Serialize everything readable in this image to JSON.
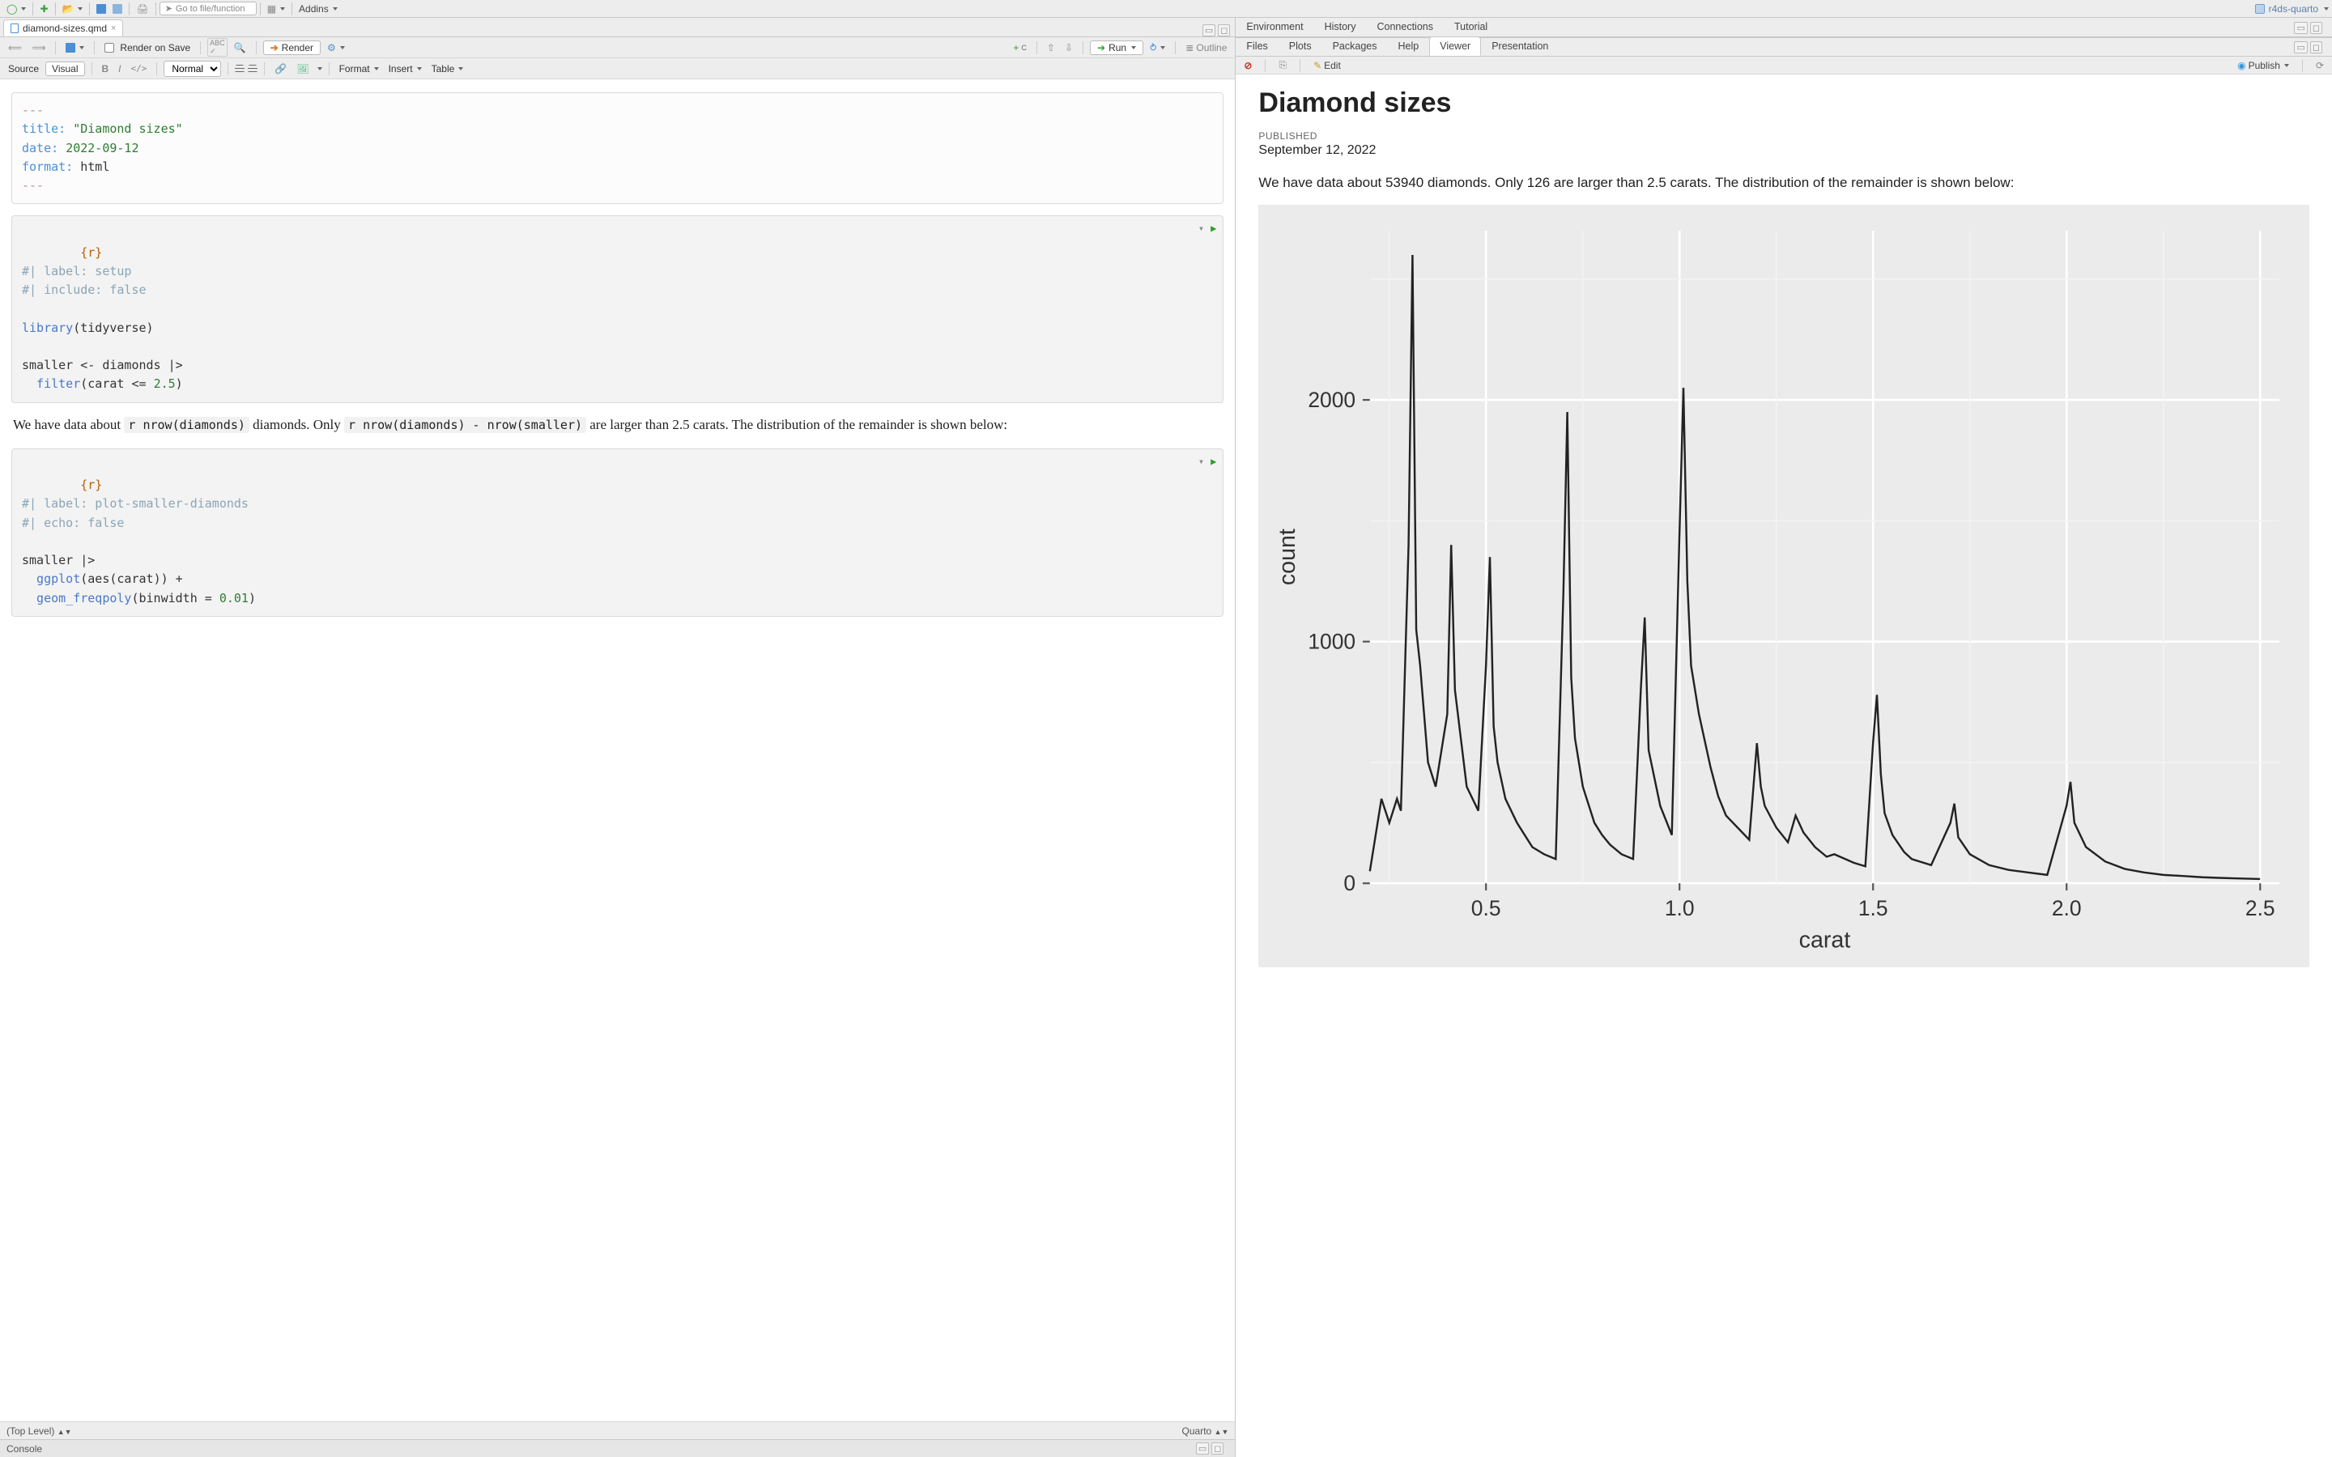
{
  "project_name": "r4ds-quarto",
  "main_toolbar": {
    "goto_placeholder": "Go to file/function",
    "addins_label": "Addins"
  },
  "file_tab": {
    "filename": "diamond-sizes.qmd"
  },
  "editor_toolbar": {
    "render_on_save": "Render on Save",
    "render": "Render",
    "run": "Run",
    "outline": "Outline"
  },
  "editor_toolbar2": {
    "source": "Source",
    "visual": "Visual",
    "normal": "Normal",
    "format": "Format",
    "insert": "Insert",
    "table": "Table"
  },
  "yaml": {
    "dashes": "---",
    "title_key": "title:",
    "title_val": "\"Diamond sizes\"",
    "date_key": "date:",
    "date_val": "2022-09-12",
    "format_key": "format:",
    "format_val": "html"
  },
  "chunk1": {
    "r": "{r}",
    "c1": "#| label: setup",
    "c2": "#| include: false",
    "lib_fn": "library",
    "lib_arg": "(tidyverse)",
    "assign": "smaller <- diamonds |>",
    "filter_fn": "  filter",
    "filter_args": "(carat <= ",
    "filter_num": "2.5",
    "close": ")"
  },
  "prose": {
    "t1": "We have data about ",
    "inline1": "r nrow(diamonds)",
    "t2": " diamonds. Only ",
    "inline2": "r nrow(diamonds) - nrow(smaller)",
    "t3": " are larger than 2.5 carats. The distribution of the remainder is shown below:"
  },
  "chunk2": {
    "r": "{r}",
    "c1": "#| label: plot-smaller-diamonds",
    "c2": "#| echo: false",
    "l1": "smaller |>",
    "l2a": "  ggplot",
    "l2b": "(aes(",
    "l2c": "carat",
    "l2d": ")) +",
    "l3a": "  geom_freqpoly",
    "l3b": "(binwidth = ",
    "l3c": "0.01",
    "l3d": ")"
  },
  "editor_status": {
    "scope": "(Top Level)",
    "lang": "Quarto"
  },
  "console_label": "Console",
  "right_tabs_upper": [
    "Environment",
    "History",
    "Connections",
    "Tutorial"
  ],
  "right_tabs_lower": [
    "Files",
    "Plots",
    "Packages",
    "Help",
    "Viewer",
    "Presentation"
  ],
  "active_lower_tab": "Viewer",
  "viewer_toolbar": {
    "edit": "Edit",
    "publish": "Publish"
  },
  "viewer": {
    "title": "Diamond sizes",
    "pub_label": "PUBLISHED",
    "pub_date": "September 12, 2022",
    "paragraph": "We have data about 53940 diamonds. Only 126 are larger than 2.5 carats. The distribution of the remainder is shown below:"
  },
  "chart_data": {
    "type": "line",
    "title": "",
    "xlabel": "carat",
    "ylabel": "count",
    "xlim": [
      0.2,
      2.55
    ],
    "ylim": [
      0,
      2700
    ],
    "x_ticks": [
      0.5,
      1.0,
      1.5,
      2.0,
      2.5
    ],
    "y_ticks": [
      0,
      1000,
      2000
    ],
    "series": [
      {
        "name": "count",
        "x": [
          0.2,
          0.23,
          0.25,
          0.27,
          0.28,
          0.3,
          0.31,
          0.32,
          0.33,
          0.34,
          0.35,
          0.37,
          0.4,
          0.41,
          0.42,
          0.45,
          0.48,
          0.5,
          0.51,
          0.52,
          0.53,
          0.55,
          0.58,
          0.6,
          0.62,
          0.65,
          0.68,
          0.7,
          0.71,
          0.72,
          0.73,
          0.75,
          0.78,
          0.8,
          0.82,
          0.85,
          0.88,
          0.9,
          0.91,
          0.92,
          0.95,
          0.98,
          1.0,
          1.01,
          1.02,
          1.03,
          1.05,
          1.08,
          1.1,
          1.12,
          1.15,
          1.18,
          1.2,
          1.21,
          1.22,
          1.25,
          1.28,
          1.3,
          1.32,
          1.35,
          1.38,
          1.4,
          1.45,
          1.48,
          1.5,
          1.51,
          1.52,
          1.53,
          1.55,
          1.58,
          1.6,
          1.65,
          1.7,
          1.71,
          1.72,
          1.75,
          1.8,
          1.85,
          1.9,
          1.95,
          2.0,
          2.01,
          2.02,
          2.05,
          2.1,
          2.15,
          2.2,
          2.25,
          2.3,
          2.35,
          2.4,
          2.45,
          2.5
        ],
        "values": [
          50,
          350,
          250,
          350,
          300,
          1400,
          2600,
          1050,
          900,
          700,
          500,
          400,
          700,
          1400,
          800,
          400,
          300,
          900,
          1350,
          650,
          500,
          350,
          250,
          200,
          150,
          120,
          100,
          1200,
          1950,
          850,
          600,
          400,
          250,
          200,
          160,
          120,
          100,
          800,
          1100,
          550,
          320,
          200,
          1450,
          2050,
          1250,
          900,
          700,
          480,
          360,
          280,
          230,
          180,
          580,
          400,
          320,
          230,
          170,
          280,
          210,
          150,
          110,
          120,
          85,
          70,
          580,
          780,
          450,
          290,
          200,
          130,
          100,
          75,
          250,
          330,
          190,
          120,
          75,
          55,
          45,
          35,
          320,
          420,
          250,
          150,
          90,
          60,
          45,
          35,
          30,
          25,
          22,
          20,
          18
        ]
      }
    ]
  }
}
